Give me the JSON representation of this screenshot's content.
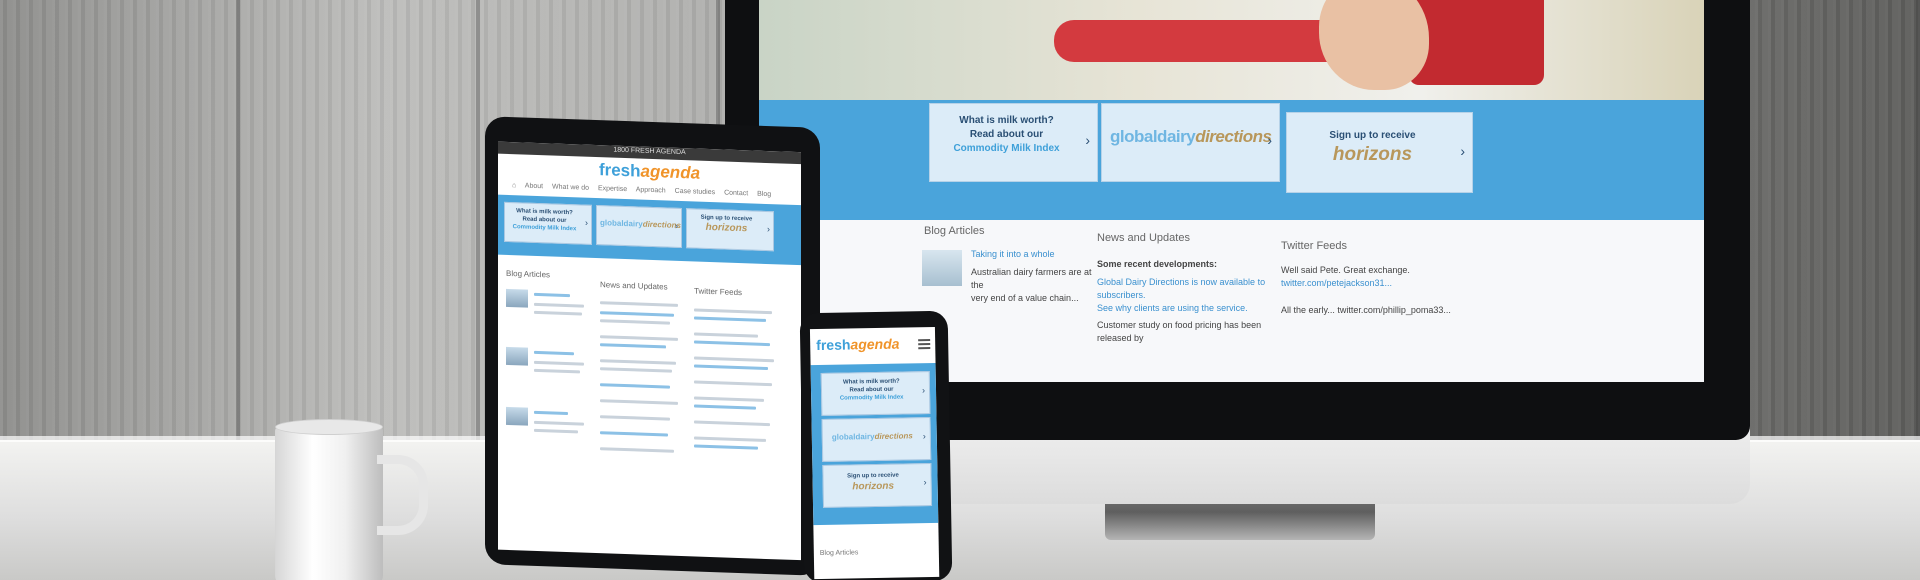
{
  "brand": {
    "fresh": "fresh",
    "agenda": "agenda"
  },
  "promos": {
    "milk_line1": "What is milk worth?",
    "milk_line2": "Read about our",
    "milk_link": "Commodity Milk Index",
    "gd_global": "globaldairy",
    "gd_directions": "directions",
    "sign_up": "Sign up to receive",
    "horizons": "horizons",
    "chevron": "›"
  },
  "desktop": {
    "blog": {
      "heading": "Blog Articles",
      "post_title": "Taking it into a whole",
      "excerpt": [
        "Australian dairy farmers are at the",
        "very end of a value chain..."
      ]
    },
    "news": {
      "heading": "News and Updates",
      "subheading": "Some recent developments:",
      "items": [
        "Global Dairy Directions is now available to subscribers.",
        "See why clients are using the service.",
        "Customer study on food pricing has been released by"
      ]
    },
    "twitter": {
      "heading": "Twitter Feeds",
      "items": [
        "Well said Pete. Great exchange.",
        "twitter.com/petejackson31..."
      ],
      "footer": "All the early... twitter.com/phillip_poma33..."
    }
  },
  "tablet": {
    "top_number": "1800 FRESH AGENDA",
    "nav": [
      "⌂",
      "About",
      "What we do",
      "Expertise",
      "Approach",
      "Case studies",
      "Contact",
      "Blog"
    ],
    "col_blog": "Blog Articles",
    "col_news": "News and Updates",
    "col_twitter": "Twitter Feeds"
  },
  "phone": {
    "blog": "Blog Articles"
  },
  "colors": {
    "brand_blue": "#3ea0d9",
    "brand_orange": "#f0942a",
    "band_blue": "#4aa4db",
    "promo_bg": "#dcecf8",
    "horizons_gold": "#b8975b"
  },
  "icons": [
    "chevron-right-icon",
    "menu-icon",
    "home-icon"
  ]
}
